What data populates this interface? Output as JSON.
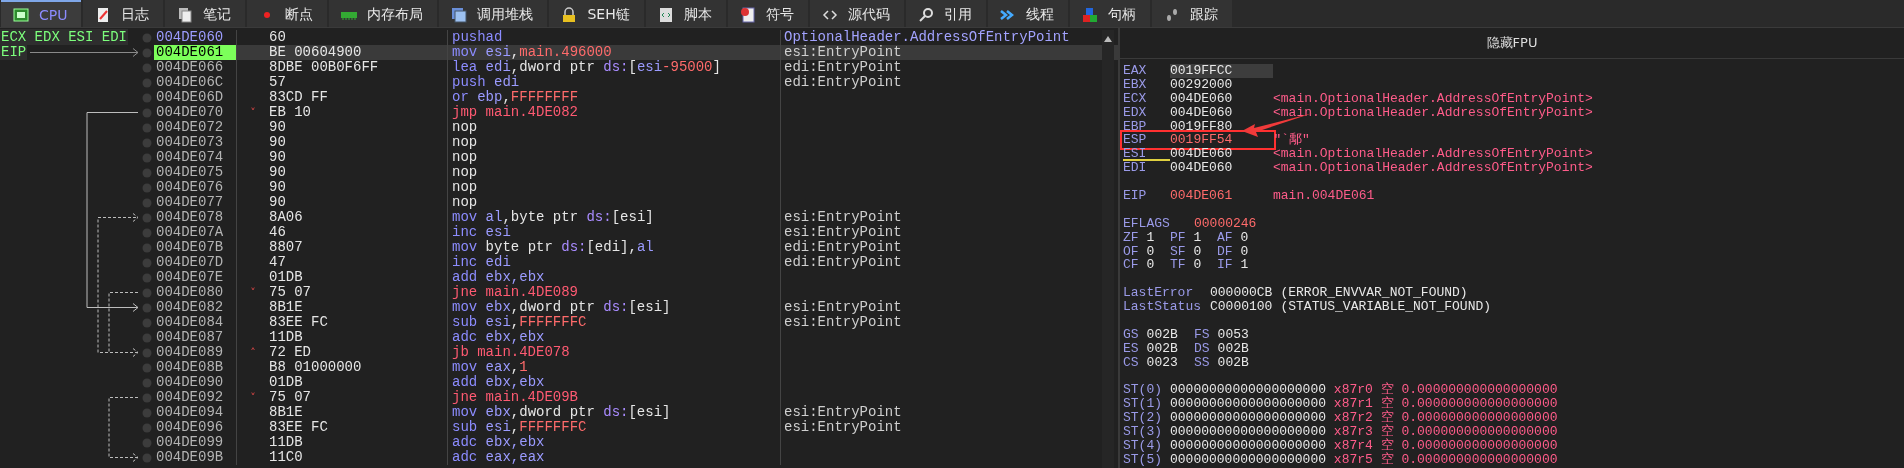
{
  "tabs": [
    {
      "label": "CPU",
      "selected": true
    },
    {
      "label": "日志",
      "selected": false
    },
    {
      "label": "笔记",
      "selected": false
    },
    {
      "label": "断点",
      "selected": false
    },
    {
      "label": "内存布局",
      "selected": false
    },
    {
      "label": "调用堆栈",
      "selected": false
    },
    {
      "label": "SEH链",
      "selected": false
    },
    {
      "label": "脚本",
      "selected": false
    },
    {
      "label": "符号",
      "selected": false
    },
    {
      "label": "源代码",
      "selected": false
    },
    {
      "label": "引用",
      "selected": false
    },
    {
      "label": "线程",
      "selected": false
    },
    {
      "label": "句柄",
      "selected": false
    },
    {
      "label": "跟踪",
      "selected": false
    }
  ],
  "disassembly": {
    "rows": [
      {
        "gutter": "ECX EDX ESI EDI",
        "address": "004DE060",
        "entry": true,
        "selected": false,
        "bytes": "60",
        "instruction": [
          {
            "text": "pushad",
            "kind": "op"
          }
        ],
        "comment": {
          "text": "OptionalHeader.AddressOfEntryPoint",
          "kind": "label"
        }
      },
      {
        "gutter": "EIP",
        "address": "004DE061",
        "entry": false,
        "selected": true,
        "bytes": "BE 00604900",
        "instruction": [
          {
            "text": "mov",
            "kind": "op"
          },
          {
            "text": " esi",
            "kind": "reg"
          },
          {
            "text": ",",
            "kind": "txt"
          },
          {
            "text": "main.496000",
            "kind": "num"
          }
        ],
        "comment": {
          "text": "esi:EntryPoint",
          "kind": "plain"
        }
      },
      {
        "address": "004DE066",
        "entry": false,
        "selected": false,
        "bytes": "8DBE 00B0F6FF",
        "instruction": [
          {
            "text": "lea",
            "kind": "op"
          },
          {
            "text": " edi",
            "kind": "reg"
          },
          {
            "text": ",dword ptr ",
            "kind": "txt"
          },
          {
            "text": "ds:",
            "kind": "seg"
          },
          {
            "text": "[",
            "kind": "txt"
          },
          {
            "text": "esi",
            "kind": "reg"
          },
          {
            "text": "-95000",
            "kind": "num"
          },
          {
            "text": "]",
            "kind": "txt"
          }
        ],
        "comment": {
          "text": "edi:EntryPoint",
          "kind": "plain"
        }
      },
      {
        "address": "004DE06C",
        "entry": false,
        "selected": false,
        "bytes": "57",
        "instruction": [
          {
            "text": "push",
            "kind": "op"
          },
          {
            "text": " edi",
            "kind": "reg"
          }
        ],
        "comment": {
          "text": "edi:EntryPoint",
          "kind": "plain"
        }
      },
      {
        "address": "004DE06D",
        "entry": false,
        "selected": false,
        "bytes": "83CD FF",
        "instruction": [
          {
            "text": "or",
            "kind": "op"
          },
          {
            "text": " ebp",
            "kind": "reg"
          },
          {
            "text": ",",
            "kind": "txt"
          },
          {
            "text": "FFFFFFFF",
            "kind": "num"
          }
        ]
      },
      {
        "address": "004DE070",
        "entry": false,
        "selected": false,
        "bytes": "EB 10",
        "branch": "˅",
        "instruction": [
          {
            "text": "jmp main.4DE082",
            "kind": "jump"
          }
        ]
      },
      {
        "address": "004DE072",
        "entry": false,
        "selected": false,
        "bytes": "90",
        "instruction": [
          {
            "text": "nop",
            "kind": "txt"
          }
        ]
      },
      {
        "address": "004DE073",
        "entry": false,
        "selected": false,
        "bytes": "90",
        "instruction": [
          {
            "text": "nop",
            "kind": "txt"
          }
        ]
      },
      {
        "address": "004DE074",
        "entry": false,
        "selected": false,
        "bytes": "90",
        "instruction": [
          {
            "text": "nop",
            "kind": "txt"
          }
        ]
      },
      {
        "address": "004DE075",
        "entry": false,
        "selected": false,
        "bytes": "90",
        "instruction": [
          {
            "text": "nop",
            "kind": "txt"
          }
        ]
      },
      {
        "address": "004DE076",
        "entry": false,
        "selected": false,
        "bytes": "90",
        "instruction": [
          {
            "text": "nop",
            "kind": "txt"
          }
        ]
      },
      {
        "address": "004DE077",
        "entry": false,
        "selected": false,
        "bytes": "90",
        "instruction": [
          {
            "text": "nop",
            "kind": "txt"
          }
        ]
      },
      {
        "address": "004DE078",
        "entry": false,
        "selected": false,
        "bytes": "8A06",
        "instruction": [
          {
            "text": "mov",
            "kind": "op"
          },
          {
            "text": " al",
            "kind": "reg"
          },
          {
            "text": ",byte ptr ",
            "kind": "txt"
          },
          {
            "text": "ds:",
            "kind": "seg"
          },
          {
            "text": "[esi]",
            "kind": "txt"
          }
        ],
        "comment": {
          "text": "esi:EntryPoint",
          "kind": "plain"
        }
      },
      {
        "address": "004DE07A",
        "entry": false,
        "selected": false,
        "bytes": "46",
        "instruction": [
          {
            "text": "inc",
            "kind": "op"
          },
          {
            "text": " esi",
            "kind": "reg"
          }
        ],
        "comment": {
          "text": "esi:EntryPoint",
          "kind": "plain"
        }
      },
      {
        "address": "004DE07B",
        "entry": false,
        "selected": false,
        "bytes": "8807",
        "instruction": [
          {
            "text": "mov",
            "kind": "op"
          },
          {
            "text": " byte ptr ",
            "kind": "txt"
          },
          {
            "text": "ds:",
            "kind": "seg"
          },
          {
            "text": "[edi],",
            "kind": "txt"
          },
          {
            "text": "al",
            "kind": "reg"
          }
        ],
        "comment": {
          "text": "edi:EntryPoint",
          "kind": "plain"
        }
      },
      {
        "address": "004DE07D",
        "entry": false,
        "selected": false,
        "bytes": "47",
        "instruction": [
          {
            "text": "inc",
            "kind": "op"
          },
          {
            "text": " edi",
            "kind": "reg"
          }
        ],
        "comment": {
          "text": "edi:EntryPoint",
          "kind": "plain"
        }
      },
      {
        "address": "004DE07E",
        "entry": false,
        "selected": false,
        "bytes": "01DB",
        "instruction": [
          {
            "text": "add",
            "kind": "op"
          },
          {
            "text": " ebx,ebx",
            "kind": "reg"
          }
        ]
      },
      {
        "address": "004DE080",
        "entry": false,
        "selected": false,
        "bytes": "75 07",
        "branch": "˅",
        "instruction": [
          {
            "text": "jne main.4DE089",
            "kind": "jump"
          }
        ]
      },
      {
        "address": "004DE082",
        "entry": false,
        "selected": false,
        "bytes": "8B1E",
        "instruction": [
          {
            "text": "mov",
            "kind": "op"
          },
          {
            "text": " ebx",
            "kind": "reg"
          },
          {
            "text": ",dword ptr ",
            "kind": "txt"
          },
          {
            "text": "ds:",
            "kind": "seg"
          },
          {
            "text": "[esi]",
            "kind": "txt"
          }
        ],
        "comment": {
          "text": "esi:EntryPoint",
          "kind": "plain"
        }
      },
      {
        "address": "004DE084",
        "entry": false,
        "selected": false,
        "bytes": "83EE FC",
        "instruction": [
          {
            "text": "sub",
            "kind": "op"
          },
          {
            "text": " esi",
            "kind": "reg"
          },
          {
            "text": ",",
            "kind": "txt"
          },
          {
            "text": "FFFFFFFC",
            "kind": "num"
          }
        ],
        "comment": {
          "text": "esi:EntryPoint",
          "kind": "plain"
        }
      },
      {
        "address": "004DE087",
        "entry": false,
        "selected": false,
        "bytes": "11DB",
        "instruction": [
          {
            "text": "adc",
            "kind": "op"
          },
          {
            "text": " ebx,ebx",
            "kind": "reg"
          }
        ]
      },
      {
        "address": "004DE089",
        "entry": false,
        "selected": false,
        "bytes": "72 ED",
        "branch": "˄",
        "instruction": [
          {
            "text": "jb main.4DE078",
            "kind": "jump"
          }
        ]
      },
      {
        "address": "004DE08B",
        "entry": false,
        "selected": false,
        "bytes": "B8 01000000",
        "instruction": [
          {
            "text": "mov",
            "kind": "op"
          },
          {
            "text": " eax",
            "kind": "reg"
          },
          {
            "text": ",",
            "kind": "txt"
          },
          {
            "text": "1",
            "kind": "num"
          }
        ]
      },
      {
        "address": "004DE090",
        "entry": false,
        "selected": false,
        "bytes": "01DB",
        "instruction": [
          {
            "text": "add",
            "kind": "op"
          },
          {
            "text": " ebx,ebx",
            "kind": "reg"
          }
        ]
      },
      {
        "address": "004DE092",
        "entry": false,
        "selected": false,
        "bytes": "75 07",
        "branch": "˅",
        "instruction": [
          {
            "text": "jne main.4DE09B",
            "kind": "jump"
          }
        ]
      },
      {
        "address": "004DE094",
        "entry": false,
        "selected": false,
        "bytes": "8B1E",
        "instruction": [
          {
            "text": "mov",
            "kind": "op"
          },
          {
            "text": " ebx",
            "kind": "reg"
          },
          {
            "text": ",dword ptr ",
            "kind": "txt"
          },
          {
            "text": "ds:",
            "kind": "seg"
          },
          {
            "text": "[esi]",
            "kind": "txt"
          }
        ],
        "comment": {
          "text": "esi:EntryPoint",
          "kind": "plain"
        }
      },
      {
        "address": "004DE096",
        "entry": false,
        "selected": false,
        "bytes": "83EE FC",
        "instruction": [
          {
            "text": "sub",
            "kind": "op"
          },
          {
            "text": " esi",
            "kind": "reg"
          },
          {
            "text": ",",
            "kind": "txt"
          },
          {
            "text": "FFFFFFFC",
            "kind": "num"
          }
        ],
        "comment": {
          "text": "esi:EntryPoint",
          "kind": "plain"
        }
      },
      {
        "address": "004DE099",
        "entry": false,
        "selected": false,
        "bytes": "11DB",
        "instruction": [
          {
            "text": "adc",
            "kind": "op"
          },
          {
            "text": " ebx,ebx",
            "kind": "reg"
          }
        ]
      },
      {
        "address": "004DE09B",
        "entry": false,
        "selected": false,
        "bytes": "11C0",
        "instruction": [
          {
            "text": "adc",
            "kind": "op"
          },
          {
            "text": " eax,eax",
            "kind": "reg"
          }
        ]
      }
    ]
  },
  "registers": {
    "header": "隐藏FPU",
    "groups": [
      [
        {
          "kind": "reg",
          "name": "EAX",
          "value": "0019FFCC",
          "selected": true,
          "changed": false,
          "underlined": false,
          "boxed": false
        },
        {
          "kind": "reg",
          "name": "EBX",
          "value": "00292000",
          "selected": false,
          "changed": false,
          "underlined": false,
          "boxed": false
        },
        {
          "kind": "reg",
          "name": "ECX",
          "value": "004DE060",
          "selected": false,
          "changed": false,
          "underlined": false,
          "boxed": false,
          "comment": "<main.OptionalHeader.AddressOfEntryPoint>"
        },
        {
          "kind": "reg",
          "name": "EDX",
          "value": "004DE060",
          "selected": false,
          "changed": false,
          "underlined": false,
          "boxed": false,
          "comment": "<main.OptionalHeader.AddressOfEntryPoint>"
        },
        {
          "kind": "reg",
          "name": "EBP",
          "value": "0019FF80",
          "selected": false,
          "changed": false,
          "underlined": false,
          "boxed": false
        },
        {
          "kind": "reg",
          "name": "ESP",
          "value": "0019FF54",
          "selected": false,
          "changed": true,
          "underlined": false,
          "boxed": true,
          "comment": "\"`鄅\""
        },
        {
          "kind": "reg",
          "name": "ESI",
          "value": "004DE060",
          "selected": false,
          "changed": false,
          "underlined": true,
          "boxed": false,
          "comment": "<main.OptionalHeader.AddressOfEntryPoint>"
        },
        {
          "kind": "reg",
          "name": "EDI",
          "value": "004DE060",
          "selected": false,
          "changed": false,
          "underlined": false,
          "boxed": false,
          "comment": "<main.OptionalHeader.AddressOfEntryPoint>"
        }
      ],
      [
        {
          "kind": "reg",
          "name": "EIP",
          "value": "004DE061",
          "selected": false,
          "changed": true,
          "underlined": false,
          "boxed": false,
          "comment": "main.004DE061"
        }
      ],
      [
        {
          "kind": "wide",
          "name": "EFLAGS",
          "value": "00000246",
          "selected": false,
          "changed": true,
          "underlined": false,
          "boxed": false
        },
        {
          "kind": "flags",
          "items": [
            {
              "name": "ZF",
              "value": "1"
            },
            {
              "name": "PF",
              "value": "1"
            },
            {
              "name": "AF",
              "value": "0"
            }
          ]
        },
        {
          "kind": "flags",
          "items": [
            {
              "name": "OF",
              "value": "0"
            },
            {
              "name": "SF",
              "value": "0"
            },
            {
              "name": "DF",
              "value": "0"
            }
          ]
        },
        {
          "kind": "flags",
          "items": [
            {
              "name": "CF",
              "value": "0"
            },
            {
              "name": "TF",
              "value": "0"
            },
            {
              "name": "IF",
              "value": "1"
            }
          ]
        }
      ],
      [
        {
          "kind": "status",
          "name": "LastError",
          "value": "000000CB",
          "comment": "(ERROR_ENVVAR_NOT_FOUND)"
        },
        {
          "kind": "status",
          "name": "LastStatus",
          "value": "C0000100",
          "comment": "(STATUS_VARIABLE_NOT_FOUND)"
        }
      ],
      [
        {
          "kind": "segments",
          "items": [
            {
              "name": "GS",
              "value": "002B"
            },
            {
              "name": "FS",
              "value": "0053"
            }
          ]
        },
        {
          "kind": "segments",
          "items": [
            {
              "name": "ES",
              "value": "002B"
            },
            {
              "name": "DS",
              "value": "002B"
            }
          ]
        },
        {
          "kind": "segments",
          "items": [
            {
              "name": "CS",
              "value": "0023"
            },
            {
              "name": "SS",
              "value": "002B"
            }
          ]
        }
      ],
      [
        {
          "kind": "fpu",
          "name": "ST(0)",
          "value": "00000000000000000000",
          "tag": "x87r0",
          "state": "空",
          "float": "0.000000000000000000"
        },
        {
          "kind": "fpu",
          "name": "ST(1)",
          "value": "00000000000000000000",
          "tag": "x87r1",
          "state": "空",
          "float": "0.000000000000000000"
        },
        {
          "kind": "fpu",
          "name": "ST(2)",
          "value": "00000000000000000000",
          "tag": "x87r2",
          "state": "空",
          "float": "0.000000000000000000"
        },
        {
          "kind": "fpu",
          "name": "ST(3)",
          "value": "00000000000000000000",
          "tag": "x87r3",
          "state": "空",
          "float": "0.000000000000000000"
        },
        {
          "kind": "fpu",
          "name": "ST(4)",
          "value": "00000000000000000000",
          "tag": "x87r4",
          "state": "空",
          "float": "0.000000000000000000"
        },
        {
          "kind": "fpu",
          "name": "ST(5)",
          "value": "00000000000000000000",
          "tag": "x87r5",
          "state": "空",
          "float": "0.000000000000000000"
        }
      ]
    ]
  }
}
